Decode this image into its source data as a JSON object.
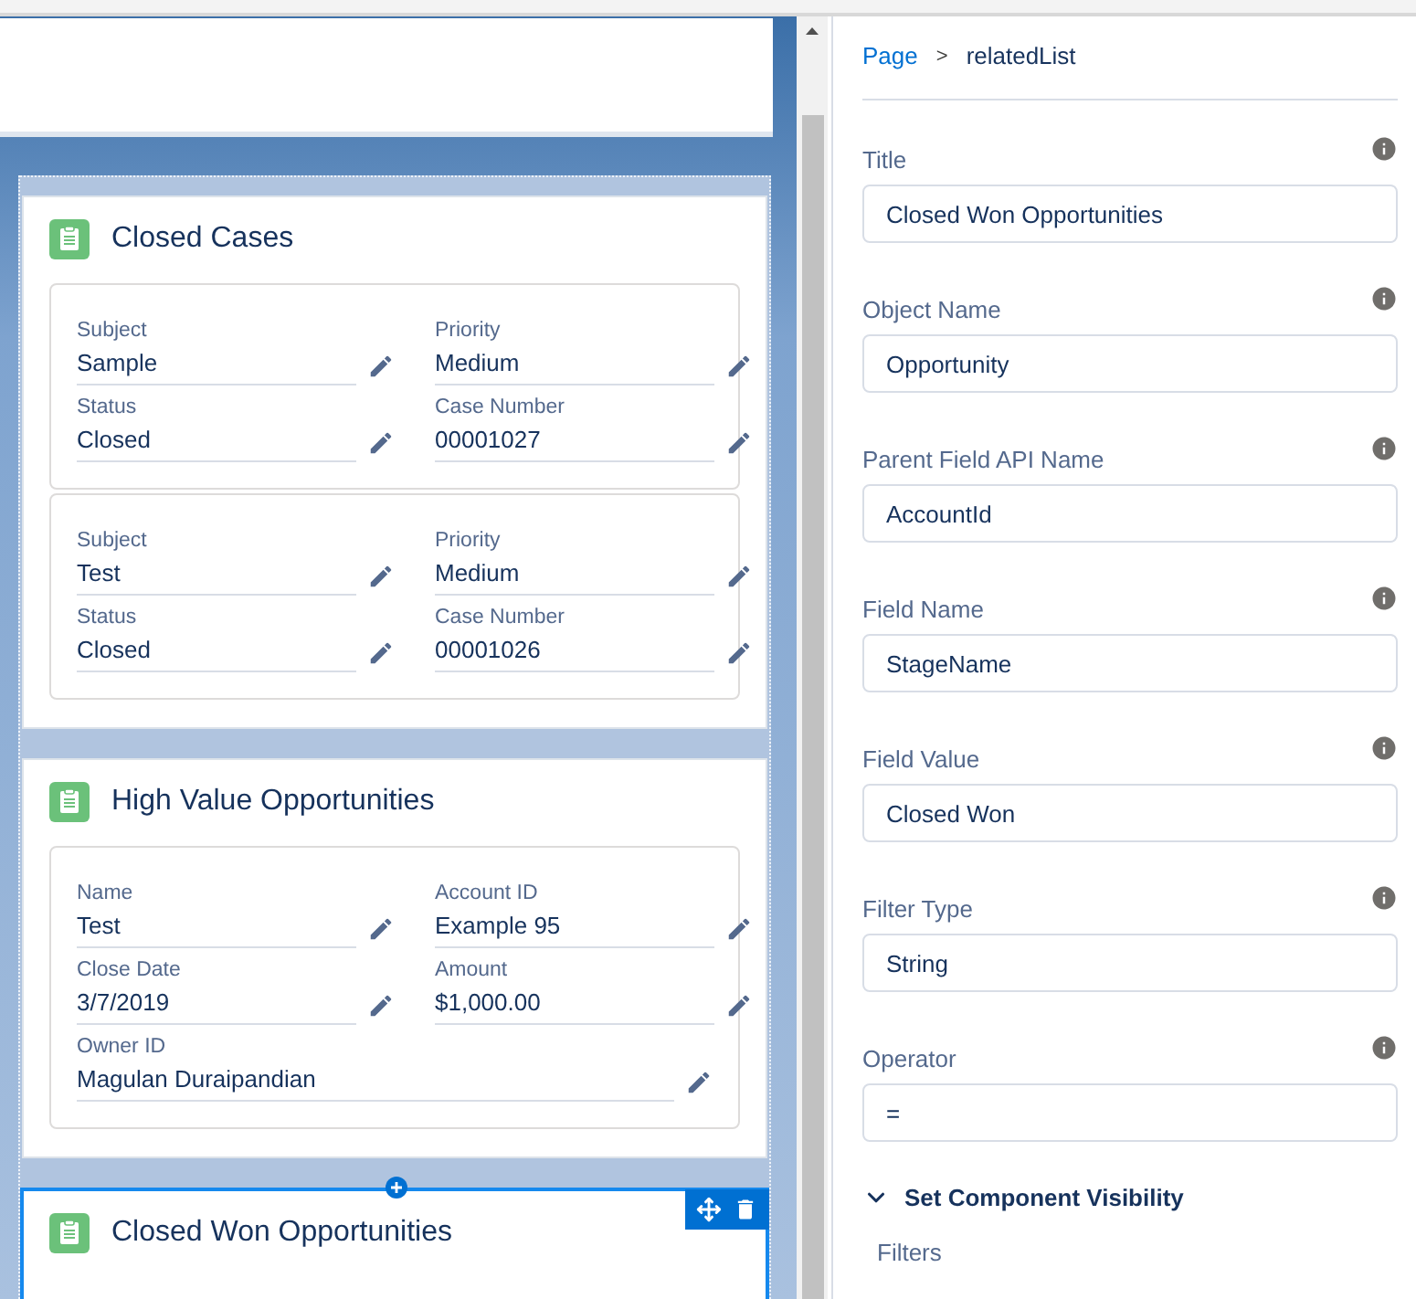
{
  "breadcrumb": {
    "items": [
      {
        "label": "Page",
        "kind": "link"
      },
      {
        "label": "relatedList",
        "kind": "current"
      }
    ],
    "separator": ">"
  },
  "canvas": {
    "components": [
      {
        "title": "Closed Cases",
        "selected": false,
        "records": [
          {
            "fields": [
              {
                "label": "Subject",
                "value": "Sample"
              },
              {
                "label": "Priority",
                "value": "Medium"
              },
              {
                "label": "Status",
                "value": "Closed"
              },
              {
                "label": "Case Number",
                "value": "00001027"
              }
            ]
          },
          {
            "fields": [
              {
                "label": "Subject",
                "value": "Test"
              },
              {
                "label": "Priority",
                "value": "Medium"
              },
              {
                "label": "Status",
                "value": "Closed"
              },
              {
                "label": "Case Number",
                "value": "00001026"
              }
            ]
          }
        ]
      },
      {
        "title": "High Value Opportunities",
        "selected": false,
        "records": [
          {
            "fields": [
              {
                "label": "Name",
                "value": "Test"
              },
              {
                "label": "Account ID",
                "value": "Example 95"
              },
              {
                "label": "Close Date",
                "value": "3/7/2019"
              },
              {
                "label": "Amount",
                "value": "$1,000.00"
              },
              {
                "label": "Owner ID",
                "value": "Magulan Duraipandian",
                "wide": true
              }
            ]
          }
        ]
      },
      {
        "title": "Closed Won Opportunities",
        "selected": true
      }
    ]
  },
  "properties": [
    {
      "label": "Title",
      "value": "Closed Won Opportunities"
    },
    {
      "label": "Object Name",
      "value": "Opportunity"
    },
    {
      "label": "Parent Field API Name",
      "value": "AccountId"
    },
    {
      "label": "Field Name",
      "value": "StageName"
    },
    {
      "label": "Field Value",
      "value": "Closed Won"
    },
    {
      "label": "Filter Type",
      "value": "String"
    },
    {
      "label": "Operator",
      "value": "="
    }
  ],
  "visibility_section": {
    "title": "Set Component Visibility",
    "expanded": true,
    "filters_label": "Filters"
  }
}
